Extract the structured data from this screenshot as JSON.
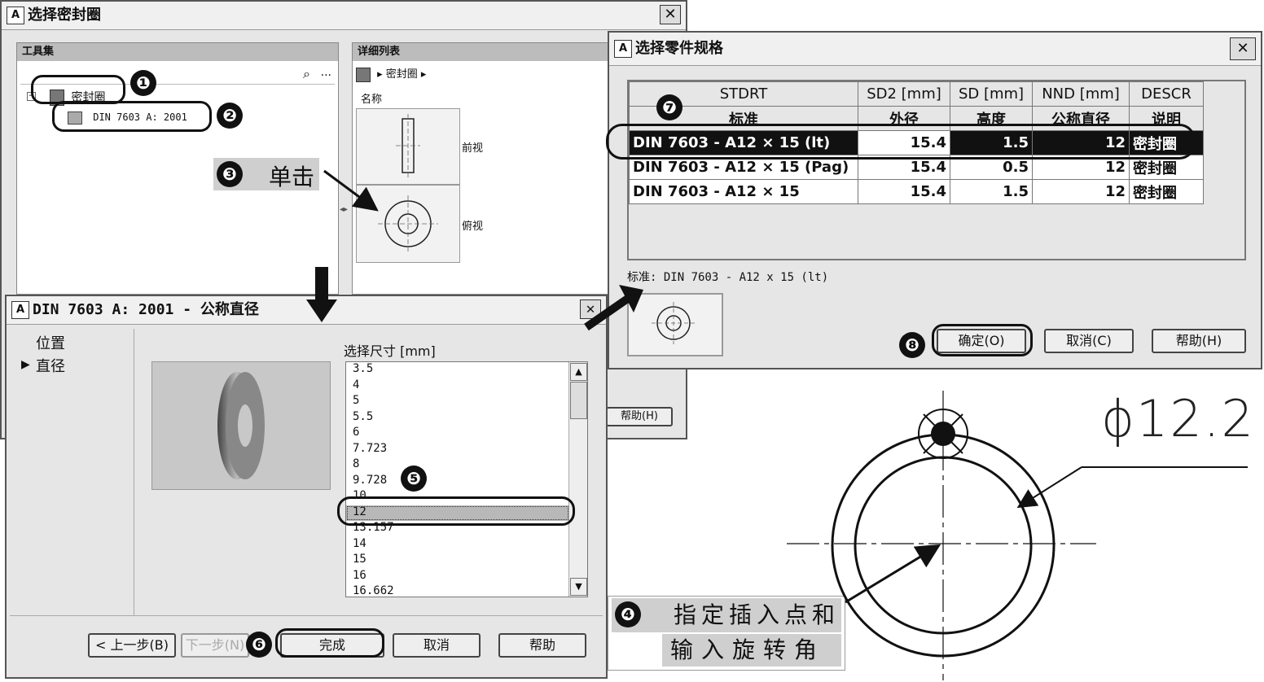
{
  "win1": {
    "title": "选择密封圈",
    "toolset_header": "工具集",
    "search_more": "...",
    "tree_root": "密封圈",
    "tree_child": "DIN 7603  A: 2001",
    "detail_header": "详细列表",
    "breadcrumb": "▸ 密封圈 ▸",
    "name_col": "名称",
    "view_front": "前视",
    "view_top": "俯视",
    "help_btn": "帮助(H)"
  },
  "win2": {
    "title": "DIN 7603  A: 2001 - 公称直径",
    "nav_items": [
      "位置",
      "直径"
    ],
    "nav_selected_marker": "▶",
    "size_label": "选择尺寸 [mm]",
    "sizes": [
      "3.5",
      "4",
      "5",
      "5.5",
      "6",
      "7.723",
      "8",
      "9.728",
      "10",
      "12",
      "13.157",
      "14",
      "15",
      "16",
      "16.662"
    ],
    "selected_size": "12",
    "btn_back": "< 上一步(B)",
    "btn_next": "下一步(N)",
    "btn_finish": "完成",
    "btn_cancel": "取消",
    "btn_help": "帮助"
  },
  "win3": {
    "title": "选择零件规格",
    "columns": [
      {
        "code": "STDRT",
        "label": "标准"
      },
      {
        "code": "SD2 [mm]",
        "label": "外径"
      },
      {
        "code": "SD [mm]",
        "label": "高度"
      },
      {
        "code": "NND [mm]",
        "label": "公称直径"
      },
      {
        "code": "DESCR",
        "label": "说明"
      }
    ],
    "rows": [
      [
        "DIN 7603 - A12 × 15  (lt)",
        "15.4",
        "1.5",
        "12",
        "密封圈"
      ],
      [
        "DIN 7603 - A12 × 15  (Pag)",
        "15.4",
        "0.5",
        "12",
        "密封圈"
      ],
      [
        "DIN 7603 - A12 × 15",
        "15.4",
        "1.5",
        "12",
        "密封圈"
      ]
    ],
    "status": "标准: DIN 7603 - A12 x 15  (lt)",
    "btn_ok": "确定(O)",
    "btn_cancel": "取消(C)",
    "btn_help": "帮助(H)"
  },
  "steps": {
    "s1": "❶",
    "s2": "❷",
    "s3": "❸",
    "s4": "❹",
    "s5": "❺",
    "s6": "❻",
    "s7": "❼",
    "s8": "❽",
    "click_label": "单击",
    "insert_line1": "指定插入点和",
    "insert_line2": "输入旋转角"
  },
  "drawing": {
    "dimension": "ϕ12.2"
  }
}
